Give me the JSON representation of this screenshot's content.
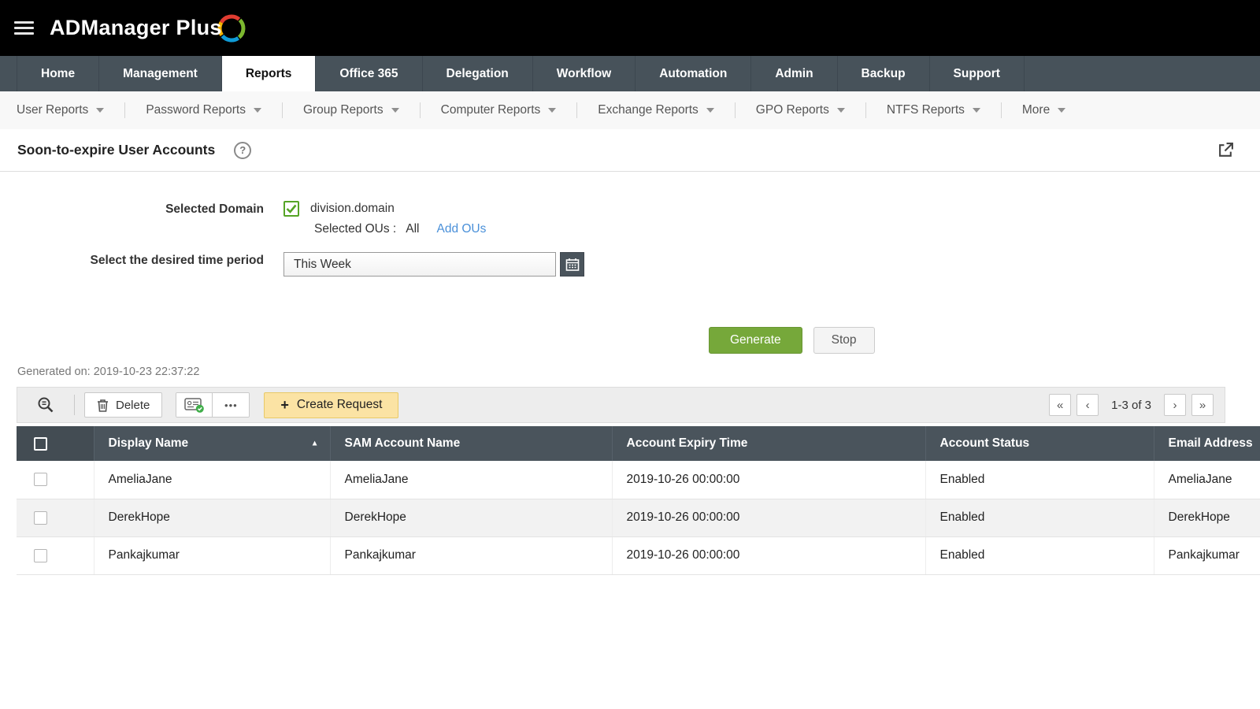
{
  "colors": {
    "topbar_bg": "#000000",
    "nav_bg": "#47525a",
    "active_tab_bg": "#ffffff",
    "link_blue": "#4a90d9",
    "check_green": "#55a426",
    "generate_green": "#76a83a",
    "create_request_yellow": "#fbe3a4",
    "toolbar_bg": "#ededed",
    "table_header_bg": "#4a545c",
    "row_alt_bg": "#f2f2f2"
  },
  "header": {
    "app_name": "ADManager Plus"
  },
  "nav": {
    "tabs": [
      "Home",
      "Management",
      "Reports",
      "Office 365",
      "Delegation",
      "Workflow",
      "Automation",
      "Admin",
      "Backup",
      "Support"
    ],
    "active_tab": "Reports"
  },
  "subnav": {
    "items": [
      "User Reports",
      "Password Reports",
      "Group Reports",
      "Computer Reports",
      "Exchange Reports",
      "GPO Reports",
      "NTFS Reports",
      "More"
    ]
  },
  "page": {
    "title": "Soon-to-expire User Accounts"
  },
  "form": {
    "selected_domain_label": "Selected Domain",
    "domain_name": "division.domain",
    "selected_ous_label": "Selected OUs :",
    "selected_ous_value": "All",
    "add_ous_link": "Add OUs",
    "time_period_label": "Select the desired time period",
    "time_period_value": "This Week"
  },
  "actions": {
    "generate_label": "Generate",
    "stop_label": "Stop"
  },
  "report": {
    "generated_on": "Generated on: 2019-10-23 22:37:22"
  },
  "toolbar": {
    "delete_label": "Delete",
    "create_request_label": "Create Request",
    "pagination_range": "1-3 of 3"
  },
  "table": {
    "columns": [
      "Display Name",
      "SAM Account Name",
      "Account Expiry Time",
      "Account Status",
      "Email Address"
    ],
    "rows": [
      {
        "display_name": "AmeliaJane",
        "sam_account_name": "AmeliaJane",
        "account_expiry_time": "2019-10-26 00:00:00",
        "account_status": "Enabled",
        "email_address": "AmeliaJane"
      },
      {
        "display_name": "DerekHope",
        "sam_account_name": "DerekHope",
        "account_expiry_time": "2019-10-26 00:00:00",
        "account_status": "Enabled",
        "email_address": "DerekHope"
      },
      {
        "display_name": "Pankajkumar",
        "sam_account_name": "Pankajkumar",
        "account_expiry_time": "2019-10-26 00:00:00",
        "account_status": "Enabled",
        "email_address": "Pankajkumar"
      }
    ]
  },
  "icons": {
    "help": "?",
    "ellipsis": "•••",
    "plus": "+",
    "sort_ascending": "▲",
    "first_page": "«",
    "previous_page": "‹",
    "next_page": "›",
    "last_page": "»"
  }
}
